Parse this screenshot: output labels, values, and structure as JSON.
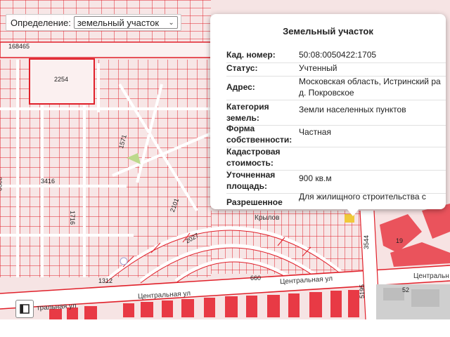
{
  "definition": {
    "label": "Определение:",
    "selected": "земельный участок",
    "chevron_icon": "chevron-down-icon"
  },
  "popup": {
    "title": "Земельный участок",
    "rows": [
      {
        "key": "Кад. номер:",
        "value": "50:08:0050422:1705"
      },
      {
        "key": "Статус:",
        "value": "Учтенный"
      },
      {
        "key": "Адрес:",
        "value_line1": "Московская область, Истринский ра",
        "value_line2": "д. Покровское"
      },
      {
        "key_line1": "Категория",
        "key_line2": "земель:",
        "value": "Земли населенных пунктов"
      },
      {
        "key_line1": "Форма",
        "key_line2": "собственности:",
        "value": "Частная"
      },
      {
        "key_line1": "Кадастровая",
        "key_line2": "стоимость:",
        "value": ""
      },
      {
        "key_line1": "Уточненная",
        "key_line2": "площадь:",
        "value": "900 кв.м"
      },
      {
        "key_line1": "Разрешенное",
        "value": "Для жилищного строительства с"
      }
    ]
  },
  "map": {
    "labels": {
      "block_168465": "168465",
      "block_2254": "2254",
      "block_3416": "3416",
      "block_2390": "2390",
      "block_1571": "1571",
      "block_1716": "1716",
      "block_2101": "2101",
      "block_2027": "2027",
      "block_1312": "1312",
      "block_660": "660",
      "block_3544": "3544",
      "block_5195": "5195",
      "block_19": "19",
      "block_52": "52",
      "street_central_1": "Центральная ул",
      "street_central_2": "Центральная ул",
      "street_central_3": "тральная ул",
      "street_krylova": "Крылов",
      "street_right": "Центральн"
    }
  },
  "colors": {
    "parcel_fill": "#f6e4e4",
    "parcel_line": "#e0202a",
    "road": "#ffffff",
    "road_shade": "#e6e6e6",
    "highlight": "#f0c93a",
    "built": "#e83a45"
  },
  "controls": {
    "layers_icon": "layers-icon"
  }
}
